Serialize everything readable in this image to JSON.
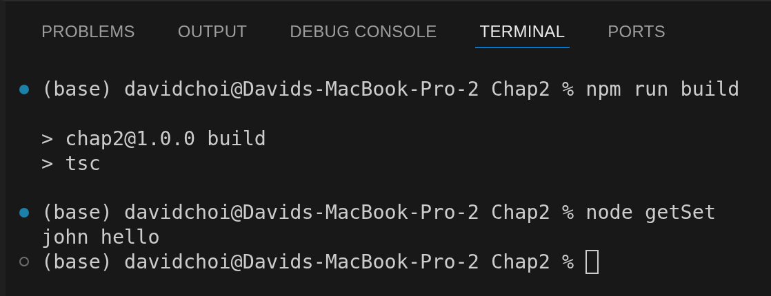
{
  "tabs": [
    {
      "label": "PROBLEMS",
      "selected": false
    },
    {
      "label": "OUTPUT",
      "selected": false
    },
    {
      "label": "DEBUG CONSOLE",
      "selected": false
    },
    {
      "label": "TERMINAL",
      "selected": true
    },
    {
      "label": "PORTS",
      "selected": false
    }
  ],
  "terminal": {
    "entries": [
      {
        "succeeded": true,
        "prompt": "(base) davidchoi@Davids-MacBook-Pro-2 Chap2 %",
        "command": "npm run build",
        "output": [
          "> chap2@1.0.0 build",
          "> tsc"
        ]
      },
      {
        "succeeded": true,
        "prompt": "(base) davidchoi@Davids-MacBook-Pro-2 Chap2 %",
        "command": "node getSet",
        "output": [
          "john hello"
        ]
      },
      {
        "succeeded": false,
        "prompt": "(base) davidchoi@Davids-MacBook-Pro-2 Chap2 %",
        "cursor": true
      }
    ]
  }
}
